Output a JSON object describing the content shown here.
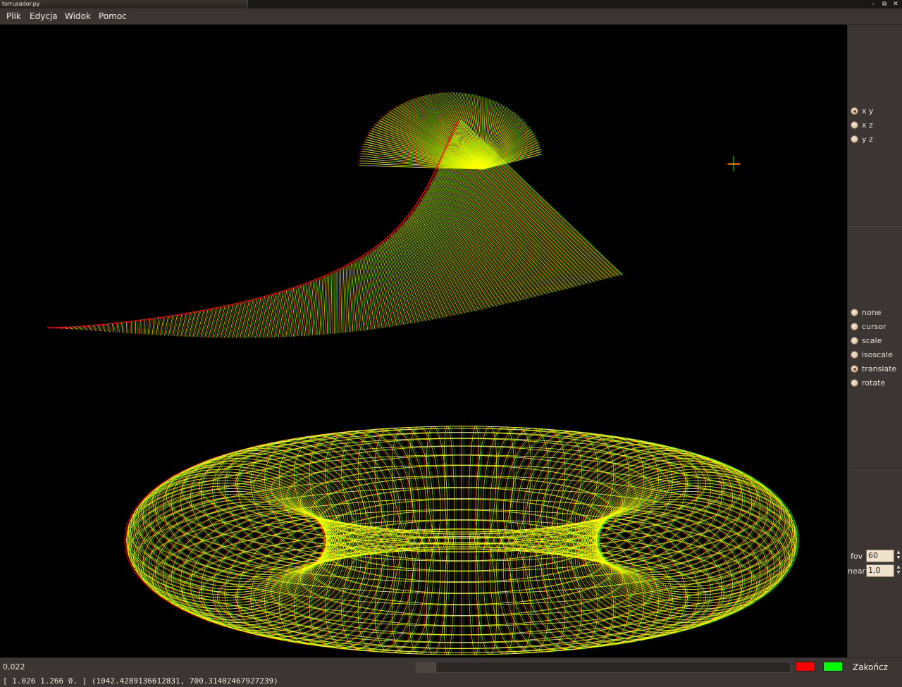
{
  "window": {
    "title": "torrusador.py",
    "buttons": [
      "–",
      "⧉",
      "✕"
    ]
  },
  "menu": [
    {
      "label": "Plik"
    },
    {
      "label": "Edycja"
    },
    {
      "label": "Widok"
    },
    {
      "label": "Pomoc"
    }
  ],
  "projection": {
    "options": [
      {
        "label": "x y",
        "checked": true
      },
      {
        "label": "x z",
        "checked": false
      },
      {
        "label": "y z",
        "checked": false
      }
    ]
  },
  "tool": {
    "options": [
      {
        "label": "none",
        "checked": false
      },
      {
        "label": "cursor",
        "checked": false
      },
      {
        "label": "scale",
        "checked": false
      },
      {
        "label": "isoscale",
        "checked": false
      },
      {
        "label": "translate",
        "checked": true
      },
      {
        "label": "rotate",
        "checked": false
      }
    ]
  },
  "camera": {
    "fov_label": "fov",
    "fov_value": "60",
    "near_label": "near",
    "near_value": "1,0"
  },
  "bottom": {
    "value": "0,022",
    "quit_label": "Zakończ",
    "colors": {
      "left": "#ff0000",
      "right": "#00ff00"
    }
  },
  "status": {
    "text": "[ 1.026  1.266  0.  ] (1042.4289136612831, 700.31402467927239)"
  },
  "colors": {
    "wire": "#ffff00",
    "canvas_bg": "#000000"
  }
}
